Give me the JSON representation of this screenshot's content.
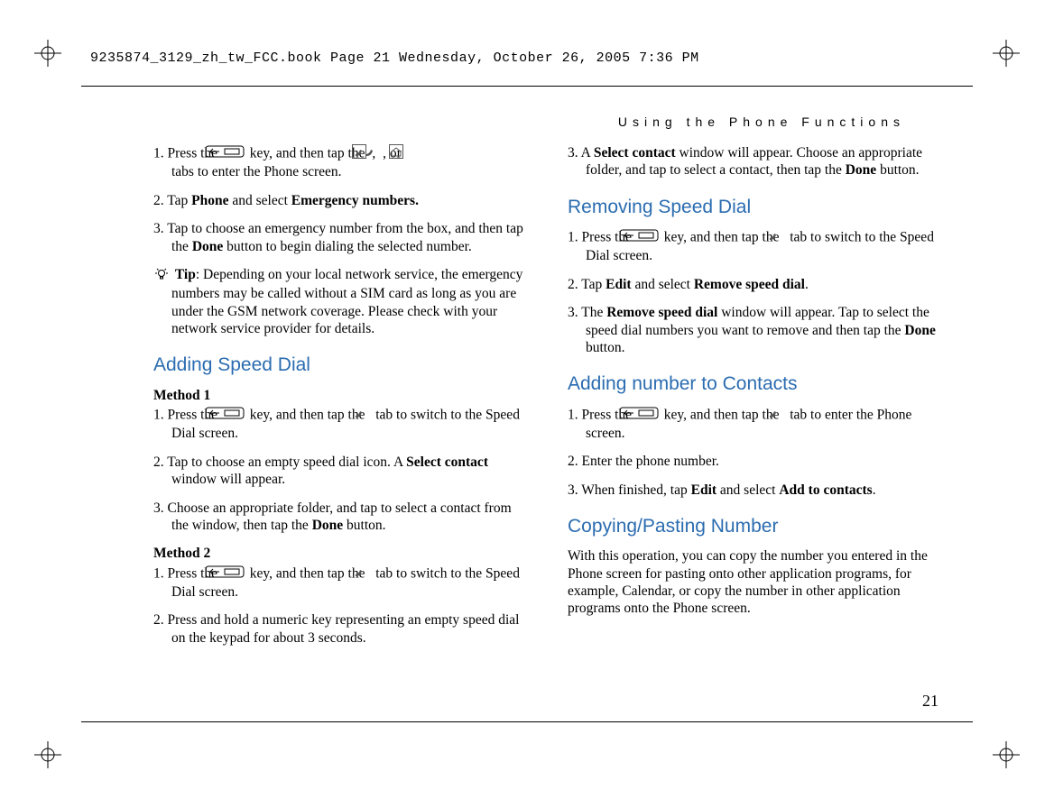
{
  "header": "9235874_3129_zh_tw_FCC.book  Page 21  Wednesday, October 26, 2005  7:36 PM",
  "running_head": "Using the Phone Functions",
  "page_number": "21",
  "left": {
    "s1_pre": "1. Press the ",
    "s1_mid1": " key, and then tap the ",
    "s1_mid2": ", ",
    "s1_mid3": ", or ",
    "s1_post": " tabs to enter the Phone screen.",
    "s2a": "2. Tap ",
    "s2b": "Phone",
    "s2c": " and select ",
    "s2d": "Emergency numbers.",
    "s3a": "3. Tap to choose an emergency number from the box, and then tap the ",
    "s3b": "Done",
    "s3c": " button to begin dialing the selected number.",
    "tip_label": "Tip",
    "tip_text": ": Depending on your local network service, the emergency numbers may be called without a SIM card as long as you are under the GSM network coverage. Please check with your network service provider for details.",
    "h1": "Adding Speed Dial",
    "m1": "Method 1",
    "m1s1_pre": "1. Press the ",
    "m1s1_mid": " key, and then tap the ",
    "m1s1_post": " tab to switch to the Speed Dial screen.",
    "m1s2a": "2. Tap to choose an empty speed dial icon. A ",
    "m1s2b": "Select contact",
    "m1s2c": " window will appear.",
    "m1s3a": "3. Choose an appropriate folder, and tap to select a contact from the window, then tap the ",
    "m1s3b": "Done",
    "m1s3c": " button.",
    "m2": "Method 2",
    "m2s1_pre": "1. Press the ",
    "m2s1_mid": " key, and then tap the ",
    "m2s1_post": " tab to switch to the Speed Dial screen.",
    "m2s2": "2. Press and hold a numeric key representing an empty speed dial on the keypad for about 3 seconds."
  },
  "right": {
    "s3a": "3. A ",
    "s3b": "Select contact",
    "s3c": " window will appear. Choose an appropriate folder, and tap to select a contact, then tap the ",
    "s3d": "Done",
    "s3e": " button.",
    "h1": "Removing Speed Dial",
    "r1_pre": "1. Press the ",
    "r1_mid": " key, and then tap the ",
    "r1_post": " tab to switch to the Speed Dial screen.",
    "r2a": "2. Tap ",
    "r2b": "Edit",
    "r2c": " and select ",
    "r2d": "Remove speed dial",
    "r2e": ".",
    "r3a": "3. The ",
    "r3b": "Remove speed dial",
    "r3c": " window will appear. Tap to select the speed dial numbers you want to remove and then tap the ",
    "r3d": "Done",
    "r3e": " button.",
    "h2": "Adding number to Contacts",
    "a1_pre": "1. Press the ",
    "a1_mid": " key, and then tap the ",
    "a1_post": " tab to enter the Phone screen.",
    "a2": "2. Enter the phone number.",
    "a3a": "3. When finished, tap ",
    "a3b": "Edit",
    "a3c": " and select ",
    "a3d": "Add to contacts",
    "a3e": ".",
    "h3": "Copying/Pasting Number",
    "cp": "With this operation, you can copy the number you entered in the Phone screen for pasting onto other application programs, for example, Calendar, or copy the number in other application programs onto the Phone screen."
  }
}
